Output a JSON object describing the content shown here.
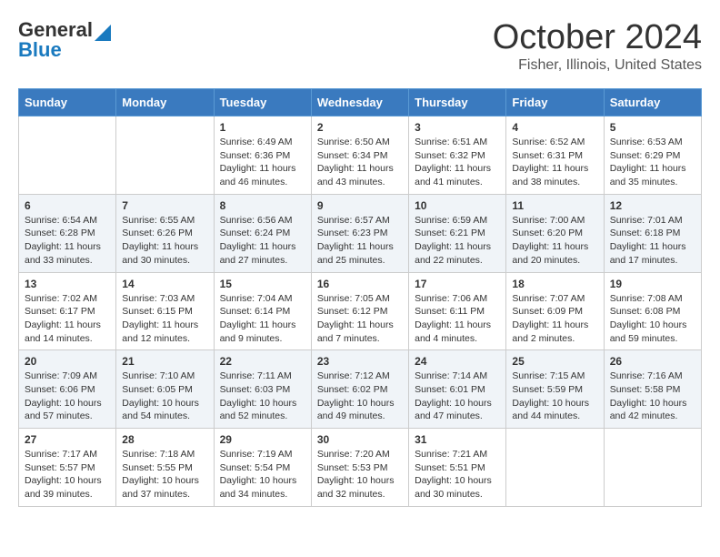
{
  "header": {
    "logo_line1": "General",
    "logo_line2": "Blue",
    "month": "October 2024",
    "location": "Fisher, Illinois, United States"
  },
  "days_of_week": [
    "Sunday",
    "Monday",
    "Tuesday",
    "Wednesday",
    "Thursday",
    "Friday",
    "Saturday"
  ],
  "weeks": [
    [
      {
        "day": "",
        "sunrise": "",
        "sunset": "",
        "daylight": ""
      },
      {
        "day": "",
        "sunrise": "",
        "sunset": "",
        "daylight": ""
      },
      {
        "day": "1",
        "sunrise": "Sunrise: 6:49 AM",
        "sunset": "Sunset: 6:36 PM",
        "daylight": "Daylight: 11 hours and 46 minutes."
      },
      {
        "day": "2",
        "sunrise": "Sunrise: 6:50 AM",
        "sunset": "Sunset: 6:34 PM",
        "daylight": "Daylight: 11 hours and 43 minutes."
      },
      {
        "day": "3",
        "sunrise": "Sunrise: 6:51 AM",
        "sunset": "Sunset: 6:32 PM",
        "daylight": "Daylight: 11 hours and 41 minutes."
      },
      {
        "day": "4",
        "sunrise": "Sunrise: 6:52 AM",
        "sunset": "Sunset: 6:31 PM",
        "daylight": "Daylight: 11 hours and 38 minutes."
      },
      {
        "day": "5",
        "sunrise": "Sunrise: 6:53 AM",
        "sunset": "Sunset: 6:29 PM",
        "daylight": "Daylight: 11 hours and 35 minutes."
      }
    ],
    [
      {
        "day": "6",
        "sunrise": "Sunrise: 6:54 AM",
        "sunset": "Sunset: 6:28 PM",
        "daylight": "Daylight: 11 hours and 33 minutes."
      },
      {
        "day": "7",
        "sunrise": "Sunrise: 6:55 AM",
        "sunset": "Sunset: 6:26 PM",
        "daylight": "Daylight: 11 hours and 30 minutes."
      },
      {
        "day": "8",
        "sunrise": "Sunrise: 6:56 AM",
        "sunset": "Sunset: 6:24 PM",
        "daylight": "Daylight: 11 hours and 27 minutes."
      },
      {
        "day": "9",
        "sunrise": "Sunrise: 6:57 AM",
        "sunset": "Sunset: 6:23 PM",
        "daylight": "Daylight: 11 hours and 25 minutes."
      },
      {
        "day": "10",
        "sunrise": "Sunrise: 6:59 AM",
        "sunset": "Sunset: 6:21 PM",
        "daylight": "Daylight: 11 hours and 22 minutes."
      },
      {
        "day": "11",
        "sunrise": "Sunrise: 7:00 AM",
        "sunset": "Sunset: 6:20 PM",
        "daylight": "Daylight: 11 hours and 20 minutes."
      },
      {
        "day": "12",
        "sunrise": "Sunrise: 7:01 AM",
        "sunset": "Sunset: 6:18 PM",
        "daylight": "Daylight: 11 hours and 17 minutes."
      }
    ],
    [
      {
        "day": "13",
        "sunrise": "Sunrise: 7:02 AM",
        "sunset": "Sunset: 6:17 PM",
        "daylight": "Daylight: 11 hours and 14 minutes."
      },
      {
        "day": "14",
        "sunrise": "Sunrise: 7:03 AM",
        "sunset": "Sunset: 6:15 PM",
        "daylight": "Daylight: 11 hours and 12 minutes."
      },
      {
        "day": "15",
        "sunrise": "Sunrise: 7:04 AM",
        "sunset": "Sunset: 6:14 PM",
        "daylight": "Daylight: 11 hours and 9 minutes."
      },
      {
        "day": "16",
        "sunrise": "Sunrise: 7:05 AM",
        "sunset": "Sunset: 6:12 PM",
        "daylight": "Daylight: 11 hours and 7 minutes."
      },
      {
        "day": "17",
        "sunrise": "Sunrise: 7:06 AM",
        "sunset": "Sunset: 6:11 PM",
        "daylight": "Daylight: 11 hours and 4 minutes."
      },
      {
        "day": "18",
        "sunrise": "Sunrise: 7:07 AM",
        "sunset": "Sunset: 6:09 PM",
        "daylight": "Daylight: 11 hours and 2 minutes."
      },
      {
        "day": "19",
        "sunrise": "Sunrise: 7:08 AM",
        "sunset": "Sunset: 6:08 PM",
        "daylight": "Daylight: 10 hours and 59 minutes."
      }
    ],
    [
      {
        "day": "20",
        "sunrise": "Sunrise: 7:09 AM",
        "sunset": "Sunset: 6:06 PM",
        "daylight": "Daylight: 10 hours and 57 minutes."
      },
      {
        "day": "21",
        "sunrise": "Sunrise: 7:10 AM",
        "sunset": "Sunset: 6:05 PM",
        "daylight": "Daylight: 10 hours and 54 minutes."
      },
      {
        "day": "22",
        "sunrise": "Sunrise: 7:11 AM",
        "sunset": "Sunset: 6:03 PM",
        "daylight": "Daylight: 10 hours and 52 minutes."
      },
      {
        "day": "23",
        "sunrise": "Sunrise: 7:12 AM",
        "sunset": "Sunset: 6:02 PM",
        "daylight": "Daylight: 10 hours and 49 minutes."
      },
      {
        "day": "24",
        "sunrise": "Sunrise: 7:14 AM",
        "sunset": "Sunset: 6:01 PM",
        "daylight": "Daylight: 10 hours and 47 minutes."
      },
      {
        "day": "25",
        "sunrise": "Sunrise: 7:15 AM",
        "sunset": "Sunset: 5:59 PM",
        "daylight": "Daylight: 10 hours and 44 minutes."
      },
      {
        "day": "26",
        "sunrise": "Sunrise: 7:16 AM",
        "sunset": "Sunset: 5:58 PM",
        "daylight": "Daylight: 10 hours and 42 minutes."
      }
    ],
    [
      {
        "day": "27",
        "sunrise": "Sunrise: 7:17 AM",
        "sunset": "Sunset: 5:57 PM",
        "daylight": "Daylight: 10 hours and 39 minutes."
      },
      {
        "day": "28",
        "sunrise": "Sunrise: 7:18 AM",
        "sunset": "Sunset: 5:55 PM",
        "daylight": "Daylight: 10 hours and 37 minutes."
      },
      {
        "day": "29",
        "sunrise": "Sunrise: 7:19 AM",
        "sunset": "Sunset: 5:54 PM",
        "daylight": "Daylight: 10 hours and 34 minutes."
      },
      {
        "day": "30",
        "sunrise": "Sunrise: 7:20 AM",
        "sunset": "Sunset: 5:53 PM",
        "daylight": "Daylight: 10 hours and 32 minutes."
      },
      {
        "day": "31",
        "sunrise": "Sunrise: 7:21 AM",
        "sunset": "Sunset: 5:51 PM",
        "daylight": "Daylight: 10 hours and 30 minutes."
      },
      {
        "day": "",
        "sunrise": "",
        "sunset": "",
        "daylight": ""
      },
      {
        "day": "",
        "sunrise": "",
        "sunset": "",
        "daylight": ""
      }
    ]
  ]
}
